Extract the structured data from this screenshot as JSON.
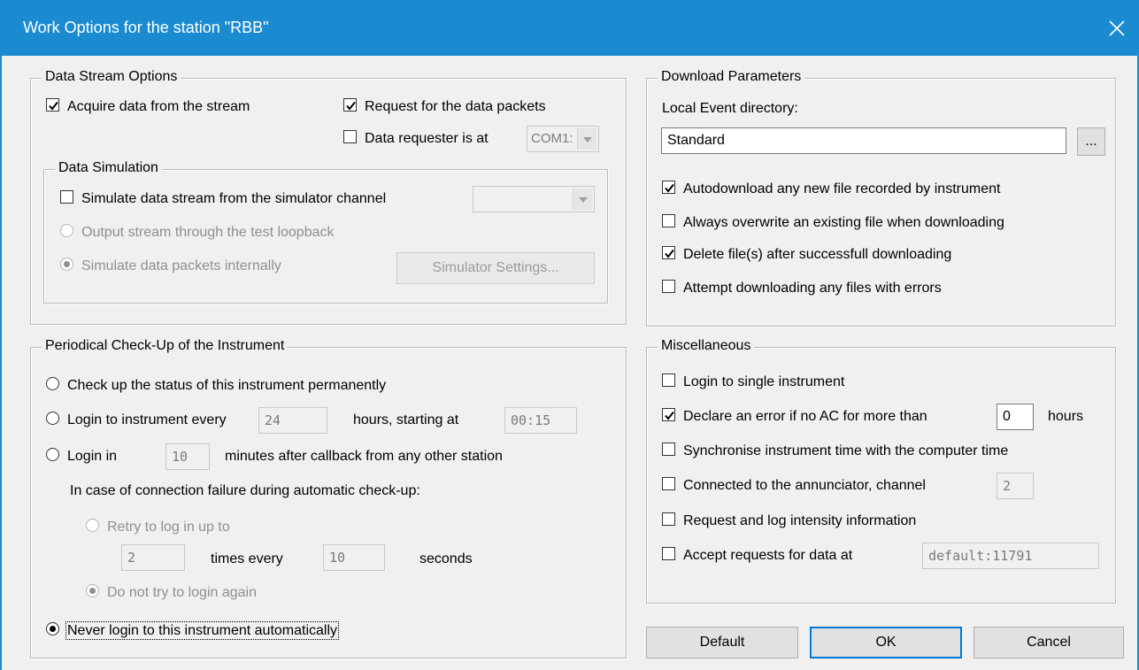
{
  "window": {
    "title": "Work Options for the station \"RBB\"",
    "close_icon": "close-icon"
  },
  "data_stream": {
    "legend": "Data Stream Options",
    "acquire": {
      "label": "Acquire data from the stream",
      "checked": true
    },
    "request_packets": {
      "label": "Request for the data packets",
      "checked": true
    },
    "requester": {
      "label": "Data requester is at",
      "checked": false,
      "port": "COM1:"
    },
    "simulation": {
      "legend": "Data Simulation",
      "simulate": {
        "label": "Simulate data stream from the simulator channel",
        "checked": false,
        "channel": ""
      },
      "output_loopback": {
        "label": "Output stream through the test loopback",
        "selected": false
      },
      "simulate_internal": {
        "label": "Simulate data packets internally",
        "selected": true
      },
      "settings_button": "Simulator Settings..."
    }
  },
  "download": {
    "legend": "Download Parameters",
    "dir_label": "Local Event directory:",
    "dir_value": "Standard",
    "browse_button": "...",
    "options": [
      {
        "label": "Autodownload any new file recorded by instrument",
        "checked": true
      },
      {
        "label": "Always overwrite an existing file when downloading",
        "checked": false
      },
      {
        "label": "Delete file(s) after successfull downloading",
        "checked": true
      },
      {
        "label": "Attempt downloading any files with errors",
        "checked": false
      }
    ]
  },
  "checkup": {
    "legend": "Periodical Check-Up of the Instrument",
    "permanent": {
      "label": "Check up the status of this instrument permanently",
      "selected": false
    },
    "every": {
      "label": "Login to instrument every",
      "hours": "24",
      "hours_label": "hours, starting at",
      "start": "00:15",
      "selected": false
    },
    "callback": {
      "label": "Login in",
      "minutes": "10",
      "after_label": "minutes after callback from any other station",
      "selected": false
    },
    "failure_label": "In case of connection failure during automatic check-up:",
    "retry": {
      "label": "Retry to log in up to",
      "times": "2",
      "times_label": "times every",
      "seconds": "10",
      "seconds_label": "seconds",
      "selected": false
    },
    "no_retry": {
      "label": "Do not try to login again",
      "selected": true
    },
    "never": {
      "label": "Never login to this instrument automatically",
      "selected": true
    }
  },
  "misc": {
    "legend": "Miscellaneous",
    "single": {
      "label": "Login to single instrument",
      "checked": false
    },
    "ac_error": {
      "label": "Declare an error if no AC for more than",
      "checked": true,
      "hours": "0",
      "hours_label": "hours"
    },
    "sync_time": {
      "label": "Synchronise instrument time with the computer time",
      "checked": false
    },
    "annunciator": {
      "label": "Connected to the annunciator, channel",
      "checked": false,
      "channel": "2"
    },
    "intensity": {
      "label": "Request and log intensity information",
      "checked": false
    },
    "accept": {
      "label": "Accept requests for data at",
      "checked": false,
      "address": "default:11791"
    }
  },
  "buttons": {
    "default": "Default",
    "ok": "OK",
    "cancel": "Cancel"
  }
}
